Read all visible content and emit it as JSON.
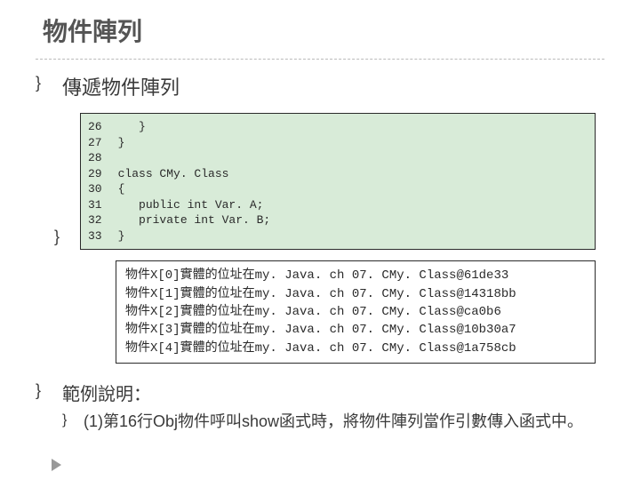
{
  "title": "物件陣列",
  "subtitle": "傳遞物件陣列",
  "code": {
    "line_numbers": "26\n27\n28\n29\n30\n31\n32\n33",
    "lines": "   }\n}\n\nclass CMy. Class\n{\n   public int Var. A;\n   private int Var. B;\n}"
  },
  "output": "物件X[0]實體的位址在my. Java. ch 07. CMy. Class@61de33\n物件X[1]實體的位址在my. Java. ch 07. CMy. Class@14318bb\n物件X[2]實體的位址在my. Java. ch 07. CMy. Class@ca0b6\n物件X[3]實體的位址在my. Java. ch 07. CMy. Class@10b30a7\n物件X[4]實體的位址在my. Java. ch 07. CMy. Class@1a758cb",
  "footer": {
    "heading": "範例說明：",
    "item": "(1)第16行Obj物件呼叫show函式時，將物件陣列當作引數傳入函式中。"
  }
}
